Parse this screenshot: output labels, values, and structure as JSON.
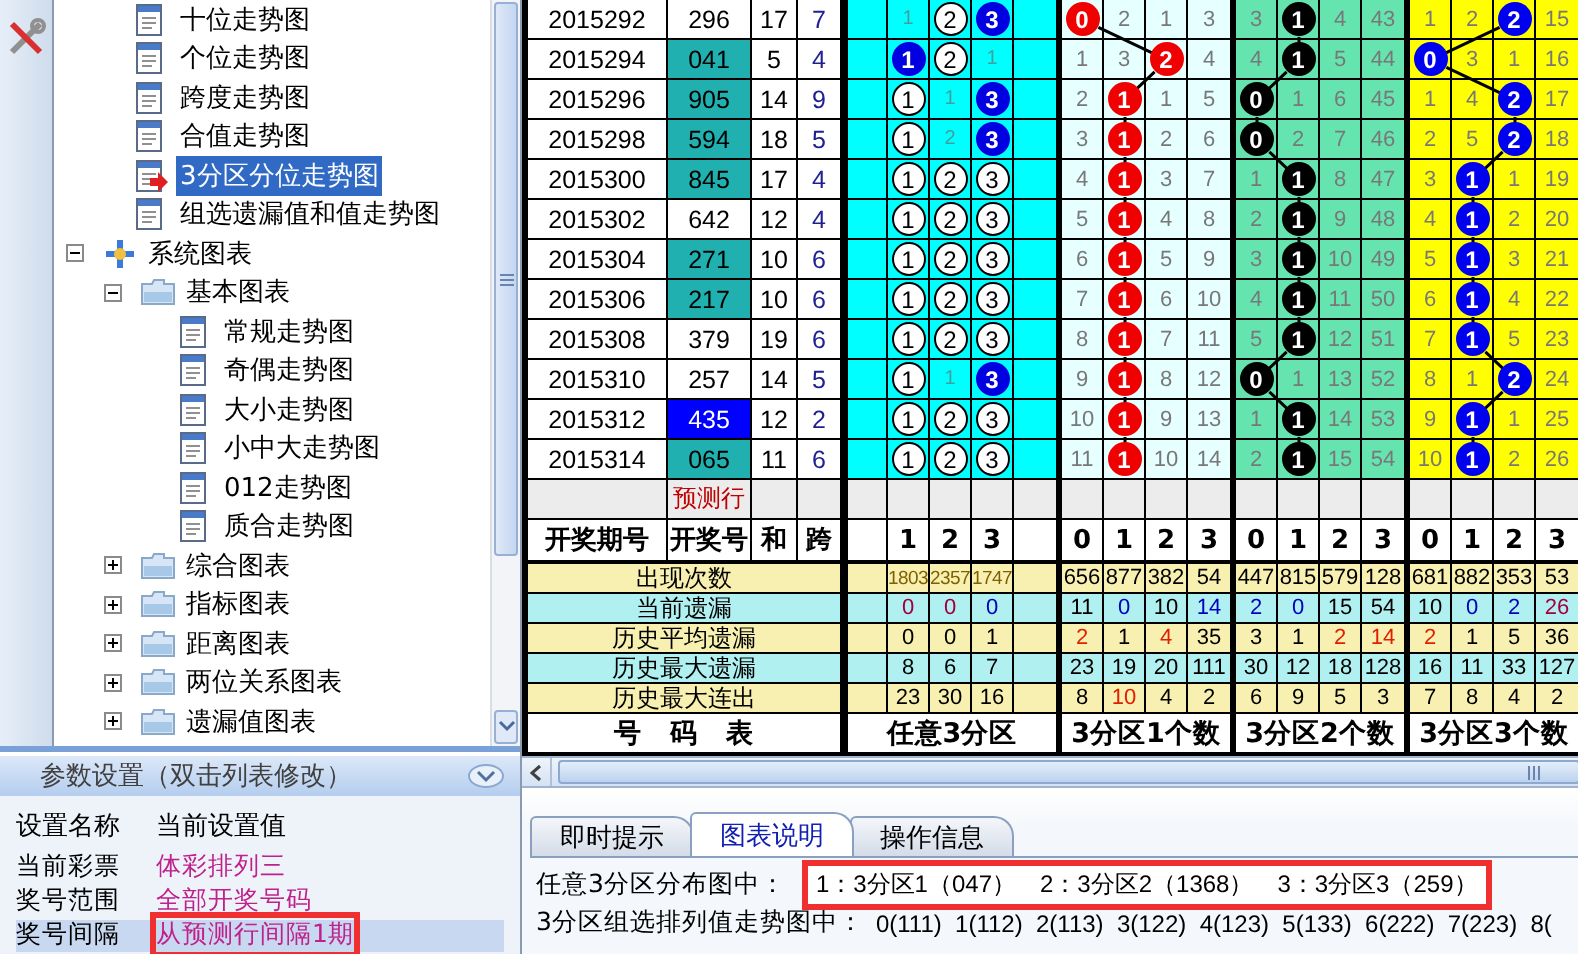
{
  "tree": {
    "items": [
      {
        "label": "十位走势图",
        "kind": "chart",
        "selected": false
      },
      {
        "label": "个位走势图",
        "kind": "chart",
        "selected": false
      },
      {
        "label": "跨度走势图",
        "kind": "chart",
        "selected": false
      },
      {
        "label": "合值走势图",
        "kind": "chart",
        "selected": false
      },
      {
        "label": "3分区分位走势图",
        "kind": "chart",
        "selected": true
      },
      {
        "label": "组选遗漏值和值走势图",
        "kind": "chart",
        "selected": false
      },
      {
        "label": "系统图表",
        "kind": "root",
        "selected": false,
        "expanded": true,
        "children": [
          {
            "label": "基本图表",
            "kind": "folder",
            "selected": false,
            "expanded": true,
            "children": [
              {
                "label": "常规走势图",
                "kind": "chart",
                "selected": false
              },
              {
                "label": "奇偶走势图",
                "kind": "chart",
                "selected": false
              },
              {
                "label": "大小走势图",
                "kind": "chart",
                "selected": false
              },
              {
                "label": "小中大走势图",
                "kind": "chart",
                "selected": false
              },
              {
                "label": "012走势图",
                "kind": "chart",
                "selected": false
              },
              {
                "label": "质合走势图",
                "kind": "chart",
                "selected": false
              }
            ]
          },
          {
            "label": "综合图表",
            "kind": "folder",
            "selected": false,
            "expanded": false
          },
          {
            "label": "指标图表",
            "kind": "folder",
            "selected": false,
            "expanded": false
          },
          {
            "label": "距离图表",
            "kind": "folder",
            "selected": false,
            "expanded": false
          },
          {
            "label": "两位关系图表",
            "kind": "folder",
            "selected": false,
            "expanded": false
          },
          {
            "label": "遗漏值图表",
            "kind": "folder",
            "selected": false,
            "expanded": false
          }
        ]
      }
    ]
  },
  "settings": {
    "title": "参数设置（双击列表修改）",
    "columns": [
      "设置名称",
      "当前设置值"
    ],
    "rows": [
      {
        "name": "当前彩票",
        "value": "体彩排列三",
        "selected": false,
        "flagged": false
      },
      {
        "name": "奖号范围",
        "value": "全部开奖号码",
        "selected": false,
        "flagged": false
      },
      {
        "name": "奖号间隔",
        "value": "从预测行间隔1期",
        "selected": true,
        "flagged": true
      }
    ]
  },
  "chart": {
    "rows": [
      {
        "period": "2015292",
        "number": "296",
        "shaded": false,
        "selected": false,
        "sum": "17",
        "span": "7",
        "zone": [
          {
            "text": "1",
            "kind": "plain"
          },
          {
            "text": "2",
            "kind": "ring"
          },
          {
            "text": "3",
            "kind": "hit"
          }
        ],
        "one": [
          {
            "text": "0",
            "ball": true
          },
          {
            "text": "2",
            "ball": false
          },
          {
            "text": "1",
            "ball": false
          },
          {
            "text": "3",
            "ball": false
          }
        ],
        "two": [
          {
            "text": "3",
            "ball": false
          },
          {
            "text": "1",
            "ball": true
          },
          {
            "text": "4",
            "ball": false
          },
          {
            "text": "43",
            "ball": false
          }
        ],
        "three": [
          {
            "text": "1",
            "ball": false
          },
          {
            "text": "2",
            "ball": false
          },
          {
            "text": "2",
            "ball": true
          },
          {
            "text": "15",
            "ball": false
          }
        ]
      },
      {
        "period": "2015294",
        "number": "041",
        "shaded": true,
        "selected": false,
        "sum": "5",
        "span": "4",
        "zone": [
          {
            "text": "1",
            "kind": "hit"
          },
          {
            "text": "2",
            "kind": "ring"
          },
          {
            "text": "1",
            "kind": "plain"
          }
        ],
        "one": [
          {
            "text": "1",
            "ball": false
          },
          {
            "text": "3",
            "ball": false
          },
          {
            "text": "2",
            "ball": true
          },
          {
            "text": "4",
            "ball": false
          }
        ],
        "two": [
          {
            "text": "4",
            "ball": false
          },
          {
            "text": "1",
            "ball": true
          },
          {
            "text": "5",
            "ball": false
          },
          {
            "text": "44",
            "ball": false
          }
        ],
        "three": [
          {
            "text": "0",
            "ball": true
          },
          {
            "text": "3",
            "ball": false
          },
          {
            "text": "1",
            "ball": false
          },
          {
            "text": "16",
            "ball": false
          }
        ]
      },
      {
        "period": "2015296",
        "number": "905",
        "shaded": true,
        "selected": false,
        "sum": "14",
        "span": "9",
        "zone": [
          {
            "text": "1",
            "kind": "ring"
          },
          {
            "text": "1",
            "kind": "plain"
          },
          {
            "text": "3",
            "kind": "hit"
          }
        ],
        "one": [
          {
            "text": "2",
            "ball": false
          },
          {
            "text": "1",
            "ball": true
          },
          {
            "text": "1",
            "ball": false
          },
          {
            "text": "5",
            "ball": false
          }
        ],
        "two": [
          {
            "text": "0",
            "ball": true
          },
          {
            "text": "1",
            "ball": false
          },
          {
            "text": "6",
            "ball": false
          },
          {
            "text": "45",
            "ball": false
          }
        ],
        "three": [
          {
            "text": "1",
            "ball": false
          },
          {
            "text": "4",
            "ball": false
          },
          {
            "text": "2",
            "ball": true
          },
          {
            "text": "17",
            "ball": false
          }
        ]
      },
      {
        "period": "2015298",
        "number": "594",
        "shaded": true,
        "selected": false,
        "sum": "18",
        "span": "5",
        "zone": [
          {
            "text": "1",
            "kind": "ring"
          },
          {
            "text": "2",
            "kind": "plain"
          },
          {
            "text": "3",
            "kind": "hit"
          }
        ],
        "one": [
          {
            "text": "3",
            "ball": false
          },
          {
            "text": "1",
            "ball": true
          },
          {
            "text": "2",
            "ball": false
          },
          {
            "text": "6",
            "ball": false
          }
        ],
        "two": [
          {
            "text": "0",
            "ball": true
          },
          {
            "text": "2",
            "ball": false
          },
          {
            "text": "7",
            "ball": false
          },
          {
            "text": "46",
            "ball": false
          }
        ],
        "three": [
          {
            "text": "2",
            "ball": false
          },
          {
            "text": "5",
            "ball": false
          },
          {
            "text": "2",
            "ball": true
          },
          {
            "text": "18",
            "ball": false
          }
        ]
      },
      {
        "period": "2015300",
        "number": "845",
        "shaded": true,
        "selected": false,
        "sum": "17",
        "span": "4",
        "zone": [
          {
            "text": "1",
            "kind": "ring"
          },
          {
            "text": "2",
            "kind": "ring"
          },
          {
            "text": "3",
            "kind": "ring"
          }
        ],
        "one": [
          {
            "text": "4",
            "ball": false
          },
          {
            "text": "1",
            "ball": true
          },
          {
            "text": "3",
            "ball": false
          },
          {
            "text": "7",
            "ball": false
          }
        ],
        "two": [
          {
            "text": "1",
            "ball": false
          },
          {
            "text": "1",
            "ball": true
          },
          {
            "text": "8",
            "ball": false
          },
          {
            "text": "47",
            "ball": false
          }
        ],
        "three": [
          {
            "text": "3",
            "ball": false
          },
          {
            "text": "1",
            "ball": true
          },
          {
            "text": "1",
            "ball": false
          },
          {
            "text": "19",
            "ball": false
          }
        ]
      },
      {
        "period": "2015302",
        "number": "642",
        "shaded": false,
        "selected": false,
        "sum": "12",
        "span": "4",
        "zone": [
          {
            "text": "1",
            "kind": "ring"
          },
          {
            "text": "2",
            "kind": "ring"
          },
          {
            "text": "3",
            "kind": "ring"
          }
        ],
        "one": [
          {
            "text": "5",
            "ball": false
          },
          {
            "text": "1",
            "ball": true
          },
          {
            "text": "4",
            "ball": false
          },
          {
            "text": "8",
            "ball": false
          }
        ],
        "two": [
          {
            "text": "2",
            "ball": false
          },
          {
            "text": "1",
            "ball": true
          },
          {
            "text": "9",
            "ball": false
          },
          {
            "text": "48",
            "ball": false
          }
        ],
        "three": [
          {
            "text": "4",
            "ball": false
          },
          {
            "text": "1",
            "ball": true
          },
          {
            "text": "2",
            "ball": false
          },
          {
            "text": "20",
            "ball": false
          }
        ]
      },
      {
        "period": "2015304",
        "number": "271",
        "shaded": true,
        "selected": false,
        "sum": "10",
        "span": "6",
        "zone": [
          {
            "text": "1",
            "kind": "ring"
          },
          {
            "text": "2",
            "kind": "ring"
          },
          {
            "text": "3",
            "kind": "ring"
          }
        ],
        "one": [
          {
            "text": "6",
            "ball": false
          },
          {
            "text": "1",
            "ball": true
          },
          {
            "text": "5",
            "ball": false
          },
          {
            "text": "9",
            "ball": false
          }
        ],
        "two": [
          {
            "text": "3",
            "ball": false
          },
          {
            "text": "1",
            "ball": true
          },
          {
            "text": "10",
            "ball": false
          },
          {
            "text": "49",
            "ball": false
          }
        ],
        "three": [
          {
            "text": "5",
            "ball": false
          },
          {
            "text": "1",
            "ball": true
          },
          {
            "text": "3",
            "ball": false
          },
          {
            "text": "21",
            "ball": false
          }
        ]
      },
      {
        "period": "2015306",
        "number": "217",
        "shaded": true,
        "selected": false,
        "sum": "10",
        "span": "6",
        "zone": [
          {
            "text": "1",
            "kind": "ring"
          },
          {
            "text": "2",
            "kind": "ring"
          },
          {
            "text": "3",
            "kind": "ring"
          }
        ],
        "one": [
          {
            "text": "7",
            "ball": false
          },
          {
            "text": "1",
            "ball": true
          },
          {
            "text": "6",
            "ball": false
          },
          {
            "text": "10",
            "ball": false
          }
        ],
        "two": [
          {
            "text": "4",
            "ball": false
          },
          {
            "text": "1",
            "ball": true
          },
          {
            "text": "11",
            "ball": false
          },
          {
            "text": "50",
            "ball": false
          }
        ],
        "three": [
          {
            "text": "6",
            "ball": false
          },
          {
            "text": "1",
            "ball": true
          },
          {
            "text": "4",
            "ball": false
          },
          {
            "text": "22",
            "ball": false
          }
        ]
      },
      {
        "period": "2015308",
        "number": "379",
        "shaded": false,
        "selected": false,
        "sum": "19",
        "span": "6",
        "zone": [
          {
            "text": "1",
            "kind": "ring"
          },
          {
            "text": "2",
            "kind": "ring"
          },
          {
            "text": "3",
            "kind": "ring"
          }
        ],
        "one": [
          {
            "text": "8",
            "ball": false
          },
          {
            "text": "1",
            "ball": true
          },
          {
            "text": "7",
            "ball": false
          },
          {
            "text": "11",
            "ball": false
          }
        ],
        "two": [
          {
            "text": "5",
            "ball": false
          },
          {
            "text": "1",
            "ball": true
          },
          {
            "text": "12",
            "ball": false
          },
          {
            "text": "51",
            "ball": false
          }
        ],
        "three": [
          {
            "text": "7",
            "ball": false
          },
          {
            "text": "1",
            "ball": true
          },
          {
            "text": "5",
            "ball": false
          },
          {
            "text": "23",
            "ball": false
          }
        ]
      },
      {
        "period": "2015310",
        "number": "257",
        "shaded": false,
        "selected": false,
        "sum": "14",
        "span": "5",
        "zone": [
          {
            "text": "1",
            "kind": "ring"
          },
          {
            "text": "1",
            "kind": "plain"
          },
          {
            "text": "3",
            "kind": "hit"
          }
        ],
        "one": [
          {
            "text": "9",
            "ball": false
          },
          {
            "text": "1",
            "ball": true
          },
          {
            "text": "8",
            "ball": false
          },
          {
            "text": "12",
            "ball": false
          }
        ],
        "two": [
          {
            "text": "0",
            "ball": true
          },
          {
            "text": "1",
            "ball": false
          },
          {
            "text": "13",
            "ball": false
          },
          {
            "text": "52",
            "ball": false
          }
        ],
        "three": [
          {
            "text": "8",
            "ball": false
          },
          {
            "text": "1",
            "ball": false
          },
          {
            "text": "2",
            "ball": true
          },
          {
            "text": "24",
            "ball": false
          }
        ]
      },
      {
        "period": "2015312",
        "number": "435",
        "shaded": false,
        "selected": true,
        "sum": "12",
        "span": "2",
        "zone": [
          {
            "text": "1",
            "kind": "ring"
          },
          {
            "text": "2",
            "kind": "ring"
          },
          {
            "text": "3",
            "kind": "ring"
          }
        ],
        "one": [
          {
            "text": "10",
            "ball": false
          },
          {
            "text": "1",
            "ball": true
          },
          {
            "text": "9",
            "ball": false
          },
          {
            "text": "13",
            "ball": false
          }
        ],
        "two": [
          {
            "text": "1",
            "ball": false
          },
          {
            "text": "1",
            "ball": true
          },
          {
            "text": "14",
            "ball": false
          },
          {
            "text": "53",
            "ball": false
          }
        ],
        "three": [
          {
            "text": "9",
            "ball": false
          },
          {
            "text": "1",
            "ball": true
          },
          {
            "text": "1",
            "ball": false
          },
          {
            "text": "25",
            "ball": false
          }
        ]
      },
      {
        "period": "2015314",
        "number": "065",
        "shaded": true,
        "selected": false,
        "sum": "11",
        "span": "6",
        "zone": [
          {
            "text": "1",
            "kind": "ring"
          },
          {
            "text": "2",
            "kind": "ring"
          },
          {
            "text": "3",
            "kind": "ring"
          }
        ],
        "one": [
          {
            "text": "11",
            "ball": false
          },
          {
            "text": "1",
            "ball": true
          },
          {
            "text": "10",
            "ball": false
          },
          {
            "text": "14",
            "ball": false
          }
        ],
        "two": [
          {
            "text": "2",
            "ball": false
          },
          {
            "text": "1",
            "ball": true
          },
          {
            "text": "15",
            "ball": false
          },
          {
            "text": "54",
            "ball": false
          }
        ],
        "three": [
          {
            "text": "10",
            "ball": false
          },
          {
            "text": "1",
            "ball": true
          },
          {
            "text": "2",
            "ball": false
          },
          {
            "text": "26",
            "ball": false
          }
        ]
      }
    ],
    "prediction_label": "预测行",
    "header": {
      "info": [
        "开奖期号",
        "开奖号",
        "和",
        "跨"
      ],
      "zone": [
        "1",
        "2",
        "3"
      ],
      "one": [
        "0",
        "1",
        "2",
        "3"
      ],
      "two": [
        "0",
        "1",
        "2",
        "3"
      ],
      "three": [
        "0",
        "1",
        "2",
        "3"
      ]
    },
    "stats": [
      {
        "label": "出现次数",
        "values": [
          {
            "text": "1803",
            "color": "#806000"
          },
          {
            "text": "2357",
            "color": "#806000"
          },
          {
            "text": "1747",
            "color": "#806000"
          },
          {
            "text": "656",
            "color": "#000000"
          },
          {
            "text": "877",
            "color": "#000000"
          },
          {
            "text": "382",
            "color": "#000000"
          },
          {
            "text": "54",
            "color": "#000000"
          },
          {
            "text": "447",
            "color": "#000000"
          },
          {
            "text": "815",
            "color": "#000000"
          },
          {
            "text": "579",
            "color": "#000000"
          },
          {
            "text": "128",
            "color": "#000000"
          },
          {
            "text": "681",
            "color": "#000000"
          },
          {
            "text": "882",
            "color": "#000000"
          },
          {
            "text": "353",
            "color": "#000000"
          },
          {
            "text": "53",
            "color": "#000000"
          }
        ]
      },
      {
        "label": "当前遗漏",
        "values": [
          {
            "text": "0",
            "color": "#a00040"
          },
          {
            "text": "0",
            "color": "#a00040"
          },
          {
            "text": "0",
            "color": "#0000c0"
          },
          {
            "text": "11",
            "color": "#000000"
          },
          {
            "text": "0",
            "color": "#0000c0"
          },
          {
            "text": "10",
            "color": "#000000"
          },
          {
            "text": "14",
            "color": "#0000c0"
          },
          {
            "text": "2",
            "color": "#0000c0"
          },
          {
            "text": "0",
            "color": "#0000c0"
          },
          {
            "text": "15",
            "color": "#000000"
          },
          {
            "text": "54",
            "color": "#000000"
          },
          {
            "text": "10",
            "color": "#000000"
          },
          {
            "text": "0",
            "color": "#0000c0"
          },
          {
            "text": "2",
            "color": "#0000c0"
          },
          {
            "text": "26",
            "color": "#a00040"
          }
        ]
      },
      {
        "label": "历史平均遗漏",
        "values": [
          {
            "text": "0",
            "color": "#000000"
          },
          {
            "text": "0",
            "color": "#000000"
          },
          {
            "text": "1",
            "color": "#000000"
          },
          {
            "text": "2",
            "color": "#e02000"
          },
          {
            "text": "1",
            "color": "#000000"
          },
          {
            "text": "4",
            "color": "#e02000"
          },
          {
            "text": "35",
            "color": "#000000"
          },
          {
            "text": "3",
            "color": "#000000"
          },
          {
            "text": "1",
            "color": "#000000"
          },
          {
            "text": "2",
            "color": "#e02000"
          },
          {
            "text": "14",
            "color": "#e02000"
          },
          {
            "text": "2",
            "color": "#e02000"
          },
          {
            "text": "1",
            "color": "#000000"
          },
          {
            "text": "5",
            "color": "#000000"
          },
          {
            "text": "36",
            "color": "#000000"
          }
        ]
      },
      {
        "label": "历史最大遗漏",
        "values": [
          {
            "text": "8",
            "color": "#000000"
          },
          {
            "text": "6",
            "color": "#000000"
          },
          {
            "text": "7",
            "color": "#000000"
          },
          {
            "text": "23",
            "color": "#000000"
          },
          {
            "text": "19",
            "color": "#000000"
          },
          {
            "text": "20",
            "color": "#000000"
          },
          {
            "text": "111",
            "color": "#000000"
          },
          {
            "text": "30",
            "color": "#000000"
          },
          {
            "text": "12",
            "color": "#000000"
          },
          {
            "text": "18",
            "color": "#000000"
          },
          {
            "text": "128",
            "color": "#000000"
          },
          {
            "text": "16",
            "color": "#000000"
          },
          {
            "text": "11",
            "color": "#000000"
          },
          {
            "text": "33",
            "color": "#000000"
          },
          {
            "text": "127",
            "color": "#000000"
          }
        ]
      },
      {
        "label": "历史最大连出",
        "values": [
          {
            "text": "23",
            "color": "#000000"
          },
          {
            "text": "30",
            "color": "#000000"
          },
          {
            "text": "16",
            "color": "#000000"
          },
          {
            "text": "8",
            "color": "#000000"
          },
          {
            "text": "10",
            "color": "#e02000"
          },
          {
            "text": "4",
            "color": "#000000"
          },
          {
            "text": "2",
            "color": "#000000"
          },
          {
            "text": "6",
            "color": "#000000"
          },
          {
            "text": "9",
            "color": "#000000"
          },
          {
            "text": "5",
            "color": "#000000"
          },
          {
            "text": "3",
            "color": "#000000"
          },
          {
            "text": "7",
            "color": "#000000"
          },
          {
            "text": "8",
            "color": "#000000"
          },
          {
            "text": "4",
            "color": "#000000"
          },
          {
            "text": "2",
            "color": "#000000"
          }
        ]
      }
    ],
    "captions": [
      "号　码　表",
      "任意3分区",
      "3分区1个数",
      "3分区2个数",
      "3分区3个数"
    ]
  },
  "info_pane": {
    "tabs": [
      {
        "label": "即时提示",
        "selected": false
      },
      {
        "label": "图表说明",
        "selected": true
      },
      {
        "label": "操作信息",
        "selected": false
      }
    ],
    "lines": [
      {
        "label": "任意3分区分布图中：",
        "text": "1：3分区1（047）　2：3分区2（1368）　3：3分区3（259）",
        "flagged": true
      },
      {
        "label": "3分区组选排列值走势图中：",
        "text": "0(111)  1(112)  2(113)  3(122)  4(123)  5(133)  6(222)  7(223)  8(",
        "flagged": false
      }
    ]
  }
}
